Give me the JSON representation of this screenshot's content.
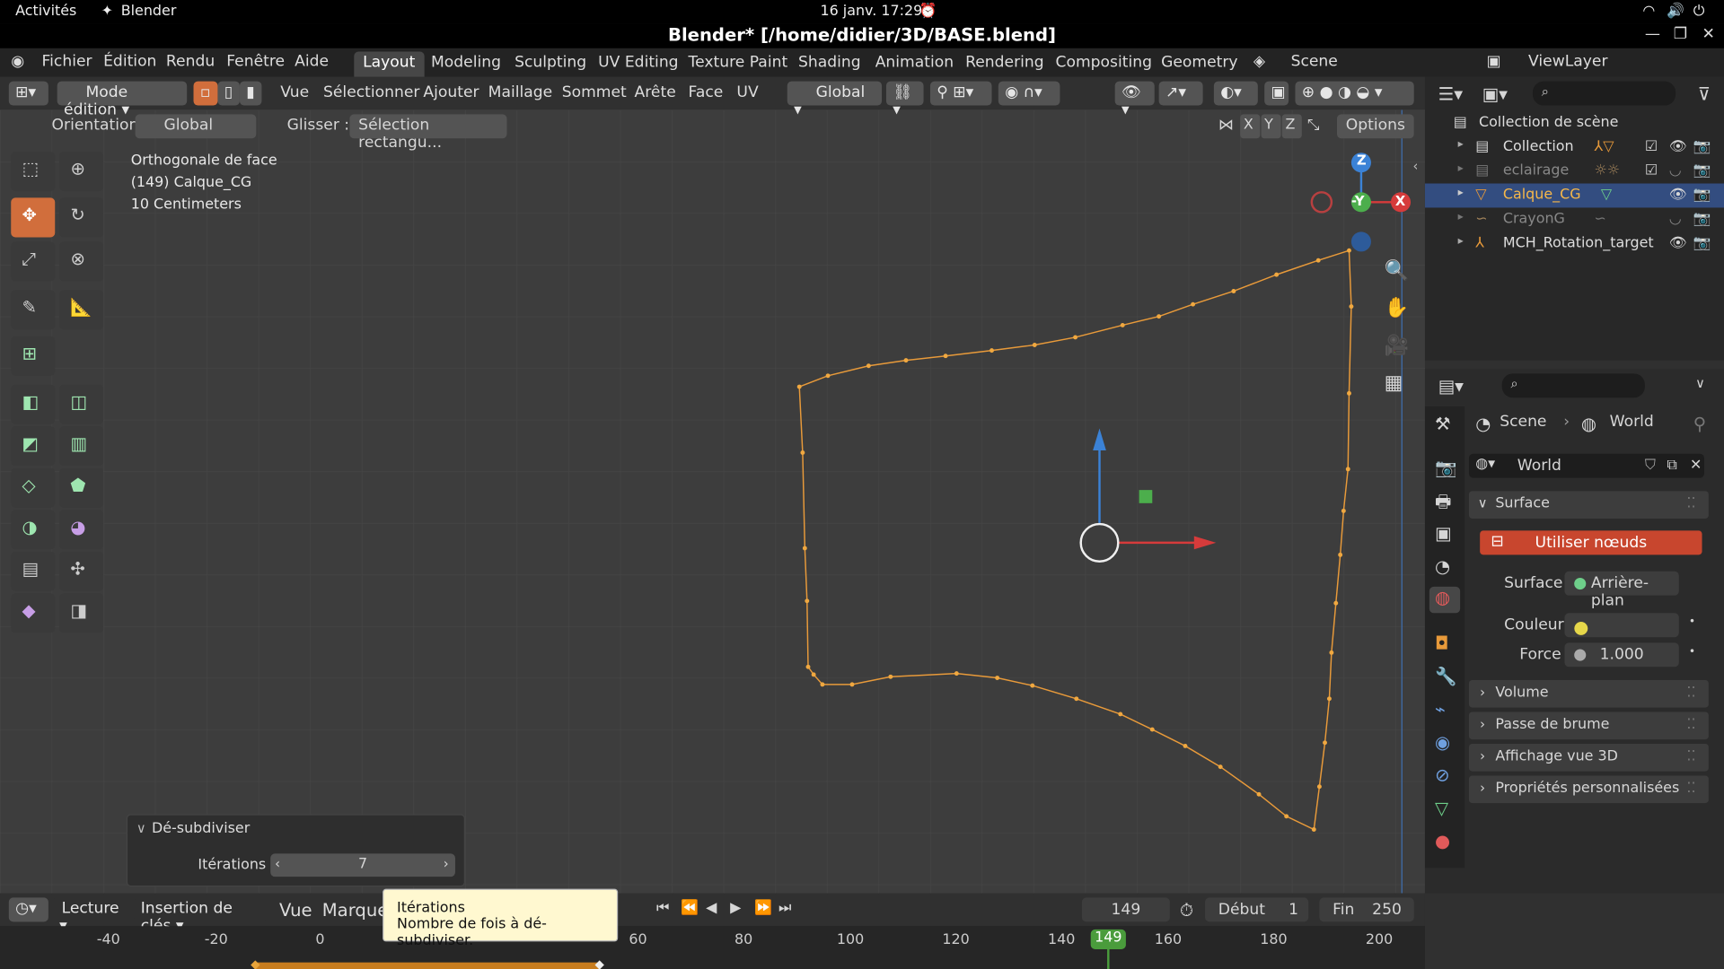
{
  "gnome": {
    "activities": "Activités",
    "app": "Blender",
    "clock": "16 janv.  17:29"
  },
  "window": {
    "title": "Blender* [/home/didier/3D/BASE.blend]"
  },
  "menus": [
    "Fichier",
    "Édition",
    "Rendu",
    "Fenêtre",
    "Aide"
  ],
  "workspaces": [
    "Layout",
    "Modeling",
    "Sculpting",
    "UV Editing",
    "Texture Paint",
    "Shading",
    "Animation",
    "Rendering",
    "Compositing",
    "Geometry N"
  ],
  "scene": "Scene",
  "viewlayer": "ViewLayer",
  "header": {
    "mode": "Mode édition",
    "menus": [
      "Vue",
      "Sélectionner",
      "Ajouter",
      "Maillage",
      "Sommet",
      "Arête",
      "Face",
      "UV"
    ],
    "orientation": "Global"
  },
  "toolsettings": {
    "orientation_label": "Orientation:",
    "orientation_value": "Global",
    "drag_label": "Glisser :",
    "drag_value": "Sélection rectangu...",
    "options": "Options"
  },
  "overlay": {
    "view": "Orthogonale de face",
    "object": "(149) Calque_CG",
    "scale": "10 Centimeters"
  },
  "gizmo": {
    "z": "Z",
    "y": "-Y",
    "x": "X"
  },
  "axis_locks": [
    "X",
    "Y",
    "Z"
  ],
  "operator": {
    "title": "Dé-subdiviser",
    "iter_label": "Itérations",
    "iter_value": "7"
  },
  "tooltip": {
    "title": "Itérations",
    "desc": "Nombre de fois à dé-subdiviser."
  },
  "outliner": {
    "root": "Collection de scène",
    "items": [
      "Collection",
      "eclairage",
      "Calque_CG",
      "CrayonG",
      "MCH_Rotation_target"
    ]
  },
  "props": {
    "breadcrumb_scene": "Scene",
    "breadcrumb_world": "World",
    "world": "World",
    "surface_panel": "Surface",
    "use_nodes": "Utiliser nœuds",
    "surface_label": "Surface",
    "surface_value": "Arrière-plan",
    "color_label": "Couleur",
    "force_label": "Force",
    "force_value": "1.000",
    "panels": [
      "Volume",
      "Passe de brume",
      "Affichage vue 3D",
      "Propriétés personnalisées"
    ]
  },
  "timeline": {
    "playback": "Lecture",
    "keying": "Insertion de clés",
    "view": "Vue",
    "markers": "Marqueur",
    "frame": "149",
    "start_label": "Début",
    "start": "1",
    "end_label": "Fin",
    "end": "250",
    "ticks": [
      "-40",
      "-20",
      "0",
      "20",
      "40",
      "60",
      "80",
      "100",
      "120",
      "140",
      "149",
      "160",
      "180",
      "200"
    ]
  },
  "colors": {
    "accent": "#d16e3c",
    "active_frame": "#4a9c3c",
    "curve": "#e89a3a",
    "selected_text": "#f5b74a"
  }
}
